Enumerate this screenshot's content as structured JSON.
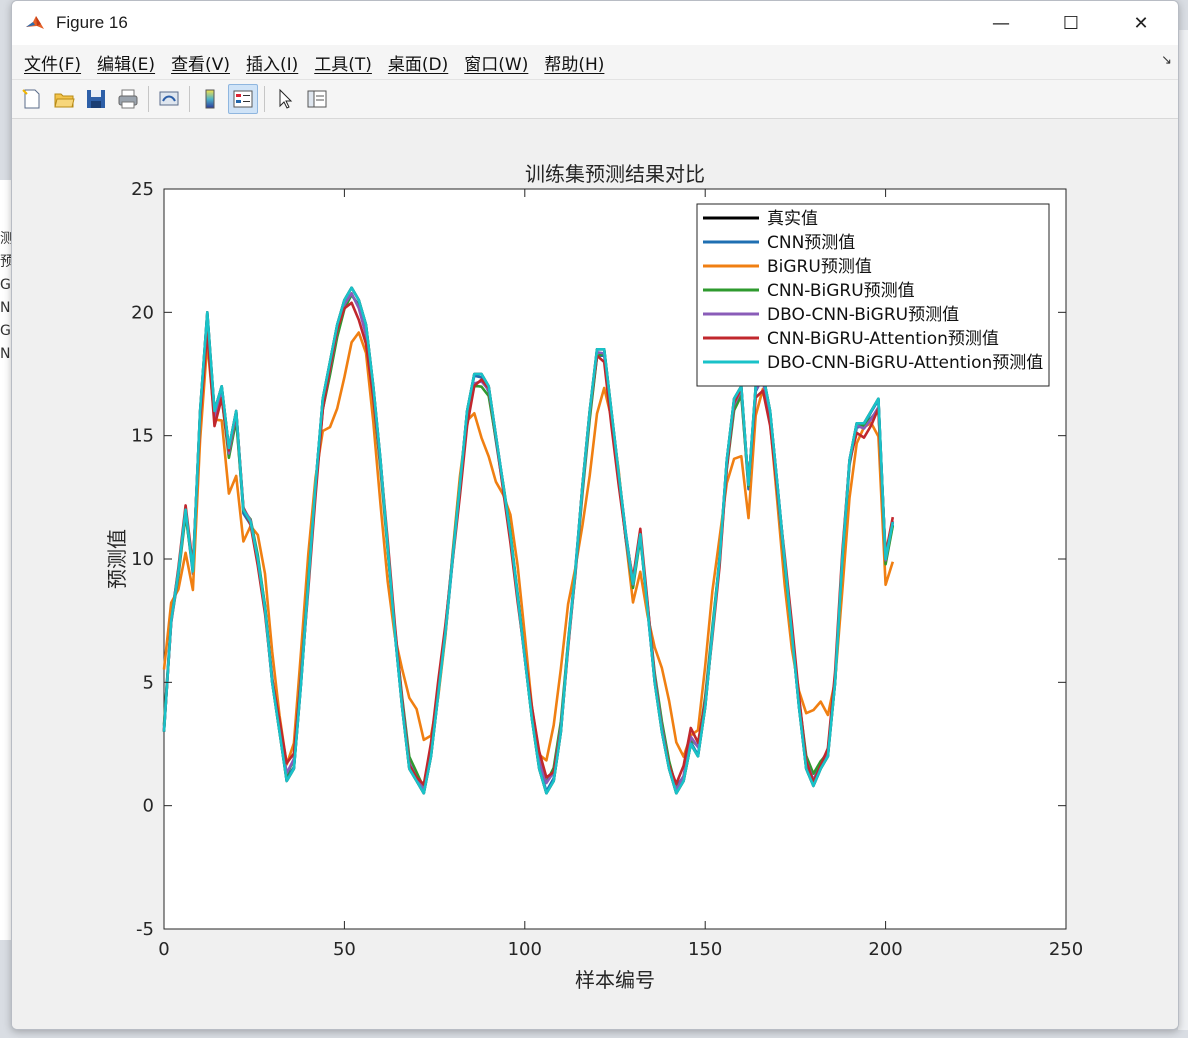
{
  "window": {
    "title": "Figure 16",
    "controls": [
      "—",
      "☐",
      "✕"
    ]
  },
  "menu": [
    {
      "label": "文件(F)"
    },
    {
      "label": "编辑(E)"
    },
    {
      "label": "查看(V)"
    },
    {
      "label": "插入(I)"
    },
    {
      "label": "工具(T)"
    },
    {
      "label": "桌面(D)"
    },
    {
      "label": "窗口(W)"
    },
    {
      "label": "帮助(H)"
    }
  ],
  "toolbar": [
    {
      "name": "new-figure-icon"
    },
    {
      "name": "open-file-icon"
    },
    {
      "name": "save-icon"
    },
    {
      "name": "print-icon"
    },
    {
      "name": "link-icon"
    },
    {
      "name": "colorbar-icon"
    },
    {
      "name": "legend-icon",
      "active": true
    },
    {
      "name": "pointer-icon"
    },
    {
      "name": "property-editor-icon"
    }
  ],
  "chart_data": {
    "type": "line",
    "title": "训练集预测结果对比",
    "xlabel": "样本编号",
    "ylabel": "预测值",
    "xlim": [
      0,
      250
    ],
    "ylim": [
      -5,
      25
    ],
    "xticks": [
      0,
      50,
      100,
      150,
      200,
      250
    ],
    "yticks": [
      -5,
      0,
      5,
      10,
      15,
      20,
      25
    ],
    "legend_position": "top-right",
    "grid": false,
    "base": {
      "x": [
        0,
        2,
        4,
        6,
        8,
        10,
        12,
        14,
        16,
        18,
        20,
        22,
        24,
        26,
        28,
        30,
        32,
        34,
        36,
        38,
        40,
        42,
        44,
        46,
        48,
        50,
        52,
        54,
        56,
        58,
        60,
        62,
        64,
        66,
        68,
        70,
        72,
        74,
        76,
        78,
        80,
        82,
        84,
        86,
        88,
        90,
        92,
        94,
        96,
        98,
        100,
        102,
        104,
        106,
        108,
        110,
        112,
        114,
        116,
        118,
        120,
        122,
        124,
        126,
        128,
        130,
        132,
        134,
        136,
        138,
        140,
        142,
        144,
        146,
        148,
        150,
        152,
        154,
        156,
        158,
        160,
        162,
        164,
        166,
        168,
        170,
        172,
        174,
        176,
        178,
        180,
        182,
        184,
        186,
        188,
        190,
        192,
        194,
        196,
        198,
        200,
        202,
        204,
        206
      ],
      "true": [
        3,
        7.5,
        9.5,
        12,
        9.5,
        16,
        20,
        16,
        17,
        14.5,
        16,
        12,
        11.5,
        10,
        8,
        5,
        3,
        1,
        1.5,
        5,
        9,
        13,
        16.5,
        18,
        19.5,
        20.5,
        21,
        20.5,
        19.5,
        17,
        14,
        10.5,
        7,
        4,
        1.5,
        1,
        0.5,
        2,
        4.5,
        7,
        10,
        13,
        16,
        17.5,
        17.5,
        17,
        15,
        13,
        11,
        8.5,
        6,
        3.5,
        1.5,
        0.5,
        1,
        3,
        6.5,
        9.5,
        13,
        16,
        18.5,
        18.5,
        16,
        13.5,
        11,
        9,
        11,
        8,
        5,
        3,
        1.5,
        0.5,
        1,
        2.5,
        2,
        4,
        7,
        10,
        14,
        16.5,
        17,
        13,
        17,
        17.5,
        16,
        13,
        10,
        7,
        4,
        1.5,
        0.8,
        1.5,
        2,
        5,
        10,
        14,
        15.5,
        15.5,
        16,
        16.5,
        10,
        11.5
      ]
    },
    "series": [
      {
        "name": "真实值",
        "color": "#000000",
        "offset": 0,
        "scale": 1.0
      },
      {
        "name": "CNN预测值",
        "color": "#1f6fb2",
        "offset": 0.1,
        "scale": 0.98
      },
      {
        "name": "BiGRU预测值",
        "color": "#f07f12",
        "offset": 1.2,
        "scale": 0.78
      },
      {
        "name": "CNN-BiGRU预测值",
        "color": "#2e9a2e",
        "offset": 0.2,
        "scale": 0.96
      },
      {
        "name": "DBO-CNN-BiGRU预测值",
        "color": "#8a5cb8",
        "offset": 0.15,
        "scale": 0.97
      },
      {
        "name": "CNN-BiGRU-Attention预测值",
        "color": "#c1272d",
        "offset": 0.3,
        "scale": 0.95
      },
      {
        "name": "DBO-CNN-BiGRU-Attention预测值",
        "color": "#19c2c8",
        "offset": 0,
        "scale": 1.0
      }
    ]
  }
}
